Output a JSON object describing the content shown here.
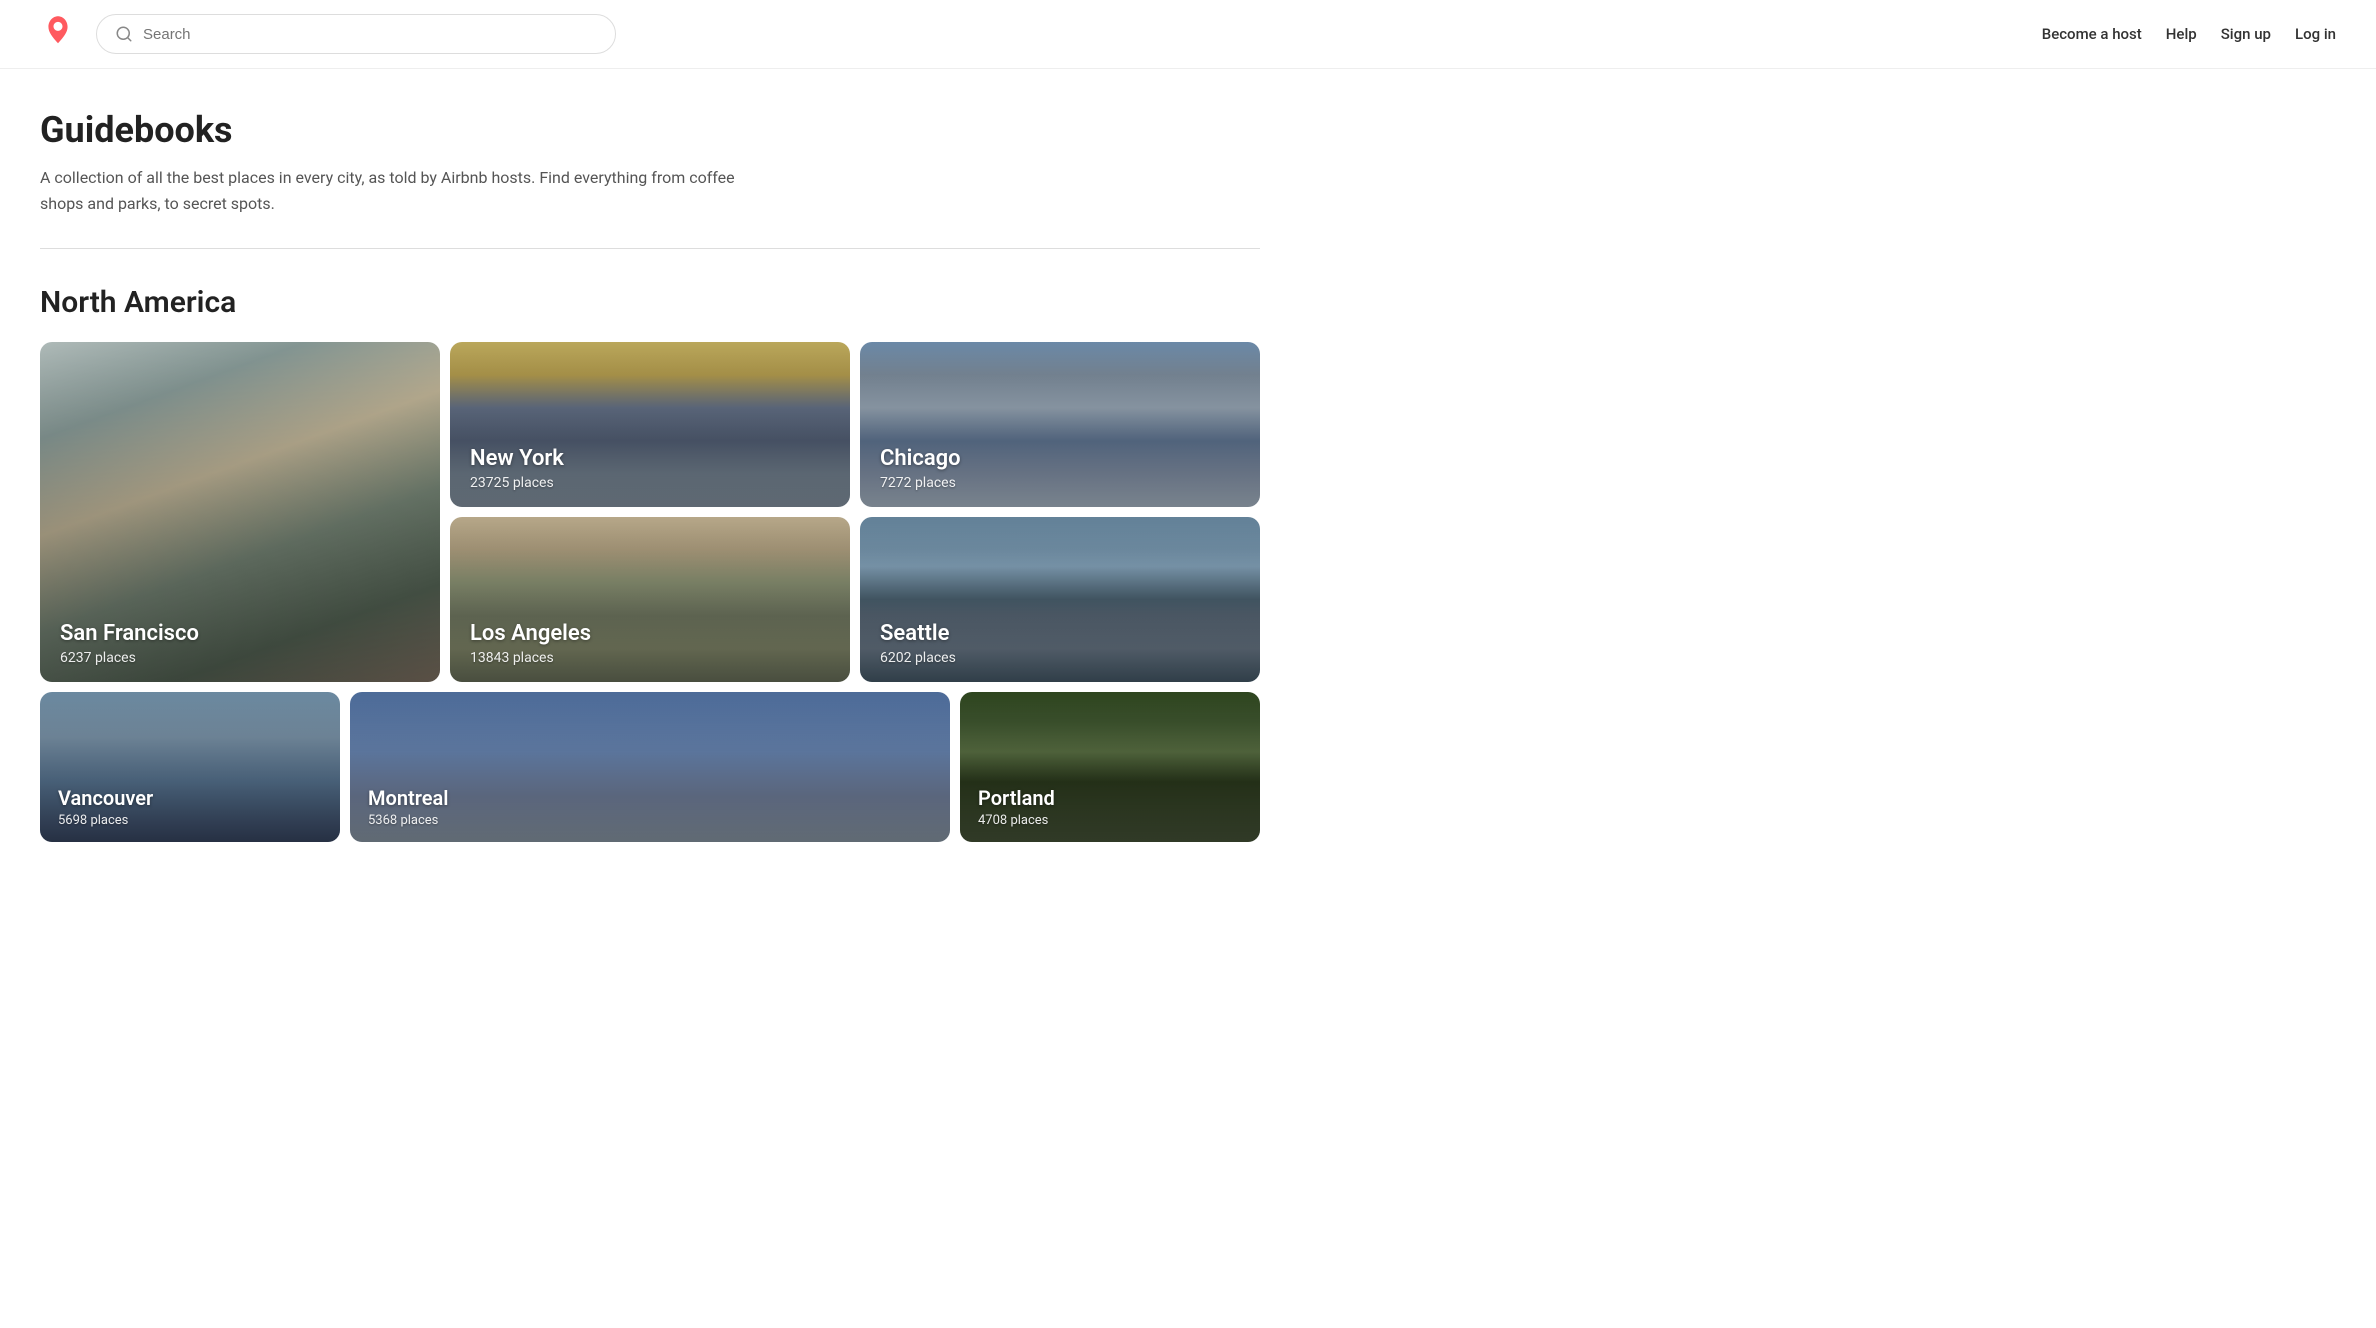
{
  "header": {
    "logo_alt": "Airbnb",
    "search_placeholder": "Search",
    "nav": [
      {
        "label": "Become a host",
        "key": "become-host"
      },
      {
        "label": "Help",
        "key": "help"
      },
      {
        "label": "Sign up",
        "key": "signup"
      },
      {
        "label": "Log in",
        "key": "login"
      }
    ]
  },
  "page": {
    "title": "Guidebooks",
    "description": "A collection of all the best places in every city, as told by Airbnb hosts. Find everything from coffee shops and parks, to secret spots."
  },
  "sections": [
    {
      "title": "North America",
      "cities_main": [
        {
          "name": "San Francisco",
          "places": "6237 places",
          "bg": "sf",
          "large": true
        },
        {
          "name": "New York",
          "places": "23725 places",
          "bg": "newyork"
        },
        {
          "name": "Chicago",
          "places": "7272 places",
          "bg": "chicago"
        },
        {
          "name": "Los Angeles",
          "places": "13843 places",
          "bg": "losangeles"
        },
        {
          "name": "Seattle",
          "places": "6202 places",
          "bg": "seattle"
        }
      ],
      "cities_bottom": [
        {
          "name": "Vancouver",
          "places": "5698 places",
          "bg": "vancouver",
          "span": 1
        },
        {
          "name": "Montreal",
          "places": "5368 places",
          "bg": "montreal",
          "span": 2
        },
        {
          "name": "Portland",
          "places": "4708 places",
          "bg": "portland",
          "span": 1
        }
      ]
    }
  ]
}
